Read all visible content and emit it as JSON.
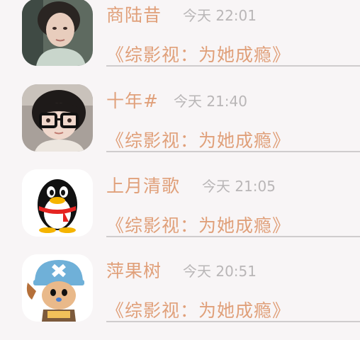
{
  "comments": [
    {
      "name": "商陆昔",
      "time": "今天 22:01",
      "message": "《综影视：为她成瘾》",
      "avatar": "girl-photo"
    },
    {
      "name": "十年#",
      "time": "今天 21:40",
      "message": "《综影视：为她成瘾》",
      "avatar": "boy-with-glasses-photo"
    },
    {
      "name": "上月清歌",
      "time": "今天 21:05",
      "message": "《综影视：为她成瘾》",
      "avatar": "qq-penguin-icon"
    },
    {
      "name": "萍果树",
      "time": "今天 20:51",
      "message": "《综影视：为她成瘾》",
      "avatar": "chopper-cartoon-icon"
    }
  ],
  "colors": {
    "name": "#e0a07a",
    "time": "#b9b6b7",
    "background": "#f8f5f6",
    "divider": "#cfcccd"
  }
}
